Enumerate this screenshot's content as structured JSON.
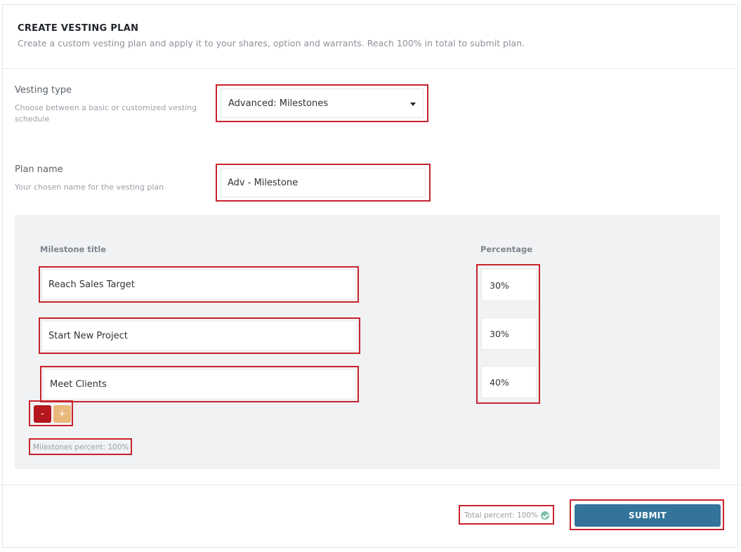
{
  "header": {
    "title": "CREATE VESTING PLAN",
    "subtitle": "Create a custom vesting plan and apply it to your shares, option and warrants. Reach 100% in total to submit plan."
  },
  "vesting_type": {
    "label": "Vesting type",
    "description": "Choose between a basic or customized vesting schedule",
    "selected": "Advanced: Milestones"
  },
  "plan_name": {
    "label": "Plan name",
    "description": "Your chosen name for the vesting plan",
    "value": "Adv - Milestone"
  },
  "milestones": {
    "title_header": "Milestone title",
    "percentage_header": "Percentage",
    "rows": [
      {
        "title": "Reach Sales Target",
        "percentage": "30%"
      },
      {
        "title": "Start New Project",
        "percentage": "30%"
      },
      {
        "title": "Meet Clients",
        "percentage": "40%"
      }
    ],
    "minus_label": "-",
    "plus_label": "+",
    "percent_text": "Milestones percent: 100%"
  },
  "footer": {
    "total_text": "Total percent: 100%",
    "submit_label": "SUBMIT"
  },
  "colors": {
    "highlight": "#c8232c",
    "submit": "#34749a",
    "minus": "#b5151c",
    "plus": "#e9b87a"
  }
}
